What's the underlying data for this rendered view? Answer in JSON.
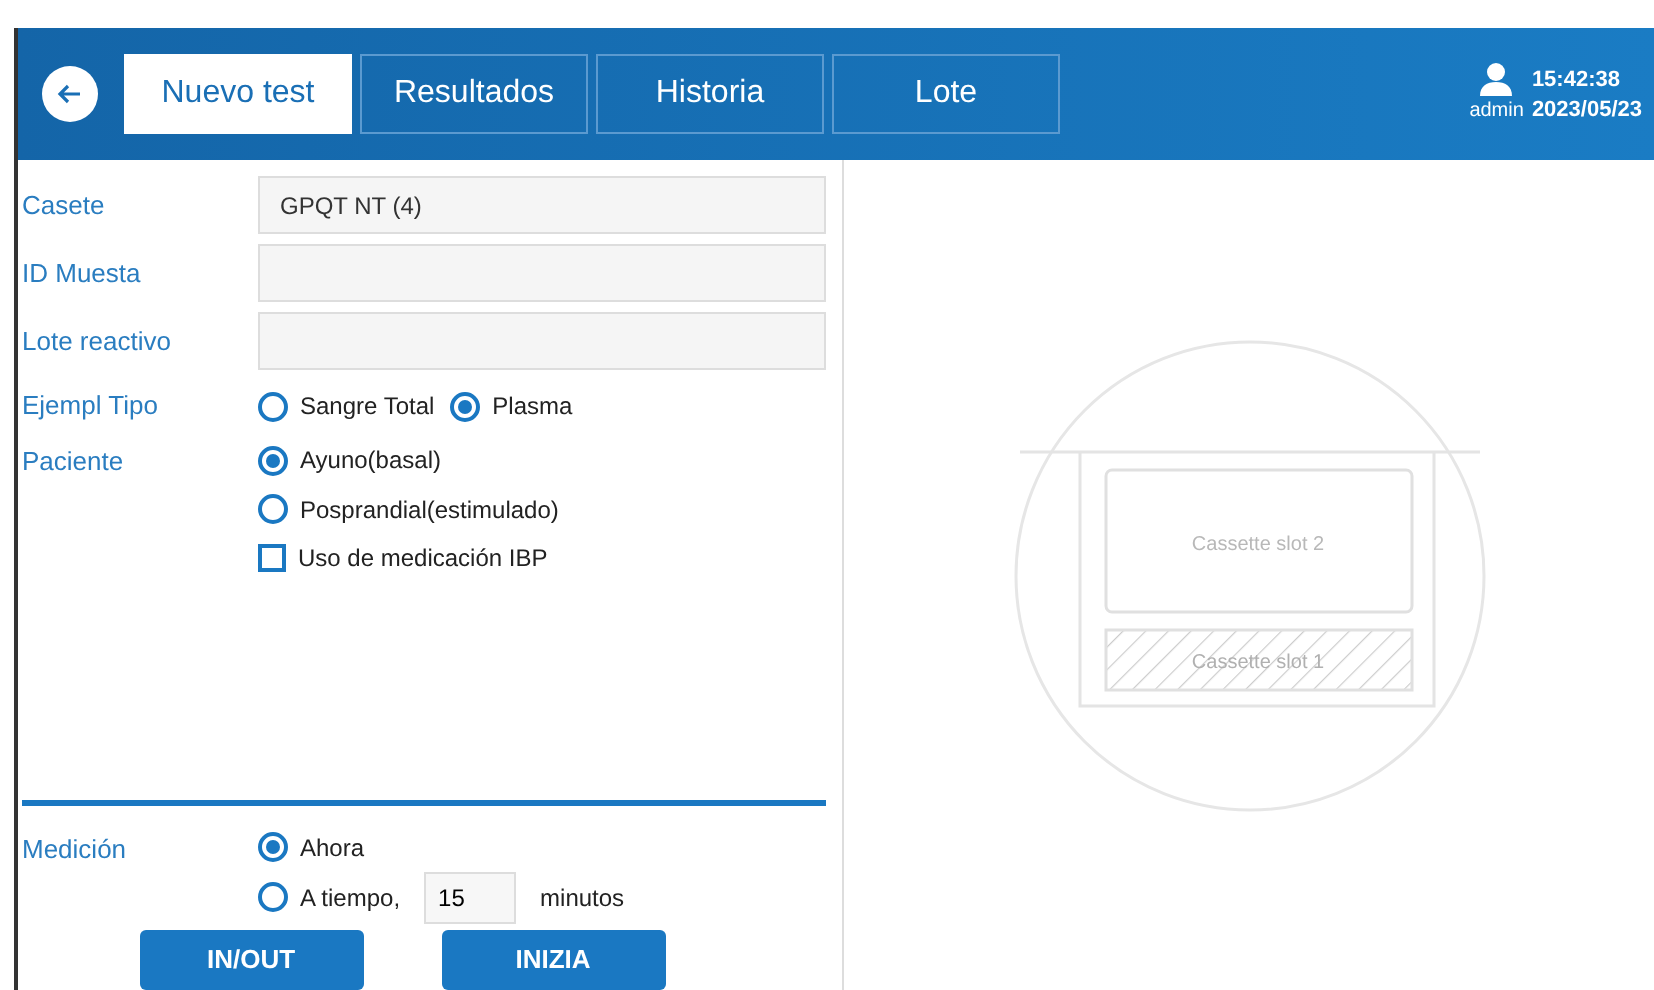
{
  "header": {
    "tabs": [
      {
        "label": "Nuevo test",
        "selected": true
      },
      {
        "label": "Resultados",
        "selected": false
      },
      {
        "label": "Historia",
        "selected": false
      },
      {
        "label": "Lote",
        "selected": false
      }
    ],
    "user": "admin",
    "time": "15:42:38",
    "date": "2023/05/23"
  },
  "form": {
    "fields": [
      {
        "label": "Casete",
        "value": "GPQT NT (4)"
      },
      {
        "label": "ID Muesta"
      },
      {
        "label": "Lote reactivo"
      }
    ],
    "sample_type": {
      "label": "Ejempl Tipo",
      "options": [
        {
          "label": "Sangre Total",
          "selected": false
        },
        {
          "label": "Plasma",
          "selected": true
        }
      ]
    },
    "patient": {
      "label": "Paciente",
      "options": [
        {
          "label": "Ayuno(basal)",
          "selected": true
        },
        {
          "label": "Posprandial(estimulado)",
          "selected": false
        }
      ],
      "medication": {
        "label": "Uso de medicación IBP",
        "checked": false
      }
    },
    "measurement": {
      "label": "Medición",
      "options": [
        {
          "label": "Ahora",
          "selected": true
        },
        {
          "label": "A tiempo,",
          "selected": false
        }
      ],
      "minutes_value": "15",
      "minutes_unit": "minutos"
    },
    "buttons": [
      "IN/OUT",
      "INIZIA"
    ]
  },
  "cassette": {
    "slots": [
      "Cassette slot 2",
      "Cassette slot 1"
    ]
  }
}
